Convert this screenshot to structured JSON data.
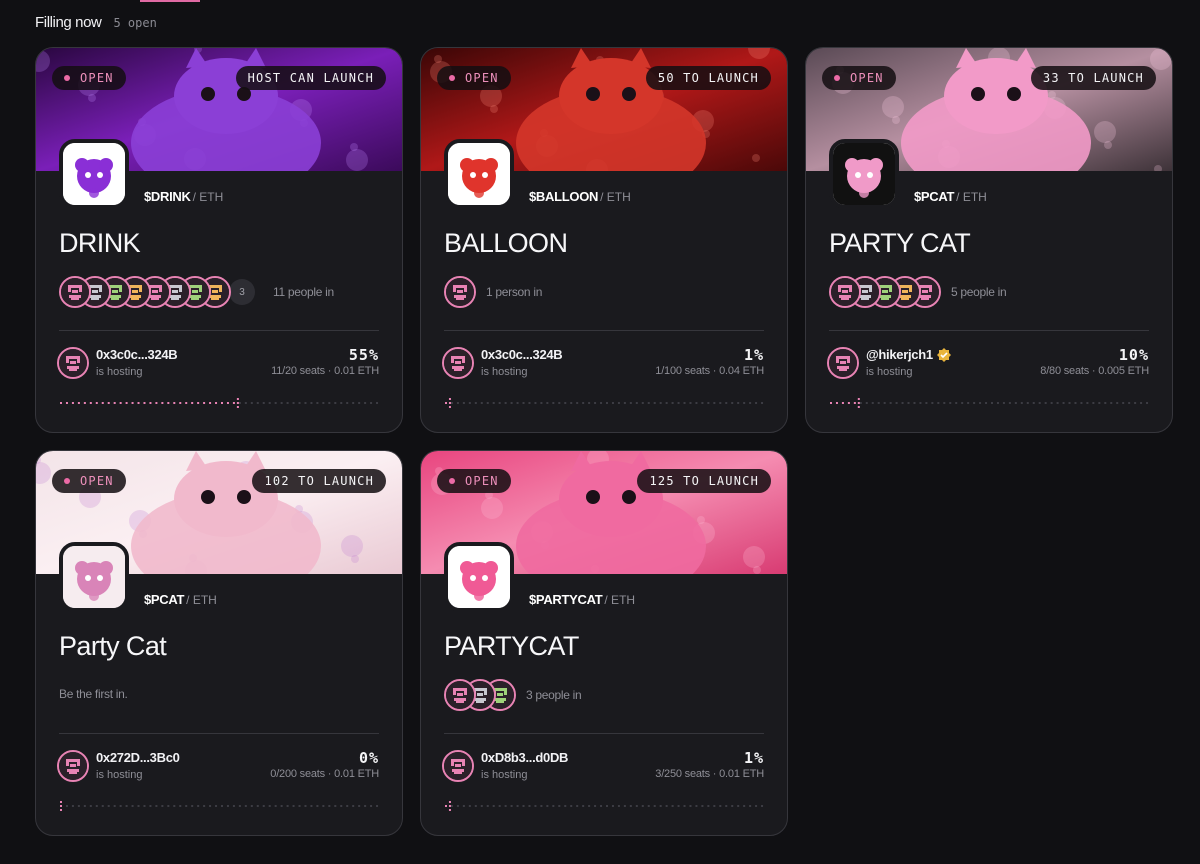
{
  "header": {
    "title": "Filling now",
    "count": "5 open"
  },
  "cards": [
    {
      "status": "OPEN",
      "launch": "HOST CAN LAUNCH",
      "ticker": "$DRINK",
      "pair": "/ ETH",
      "name": "DRINK",
      "people_more": "3",
      "people_text": "11 people in",
      "host": "0x3c0c...324B",
      "host_sub": "is hosting",
      "percent": "55%",
      "seats": "11/20 seats · 0.01 ETH",
      "progress": 0.55
    },
    {
      "status": "OPEN",
      "launch": "50 TO LAUNCH",
      "ticker": "$BALLOON",
      "pair": "/ ETH",
      "name": "BALLOON",
      "people_text": "1 person in",
      "host": "0x3c0c...324B",
      "host_sub": "is hosting",
      "percent": "1%",
      "seats": "1/100 seats · 0.04 ETH",
      "progress": 0.01
    },
    {
      "status": "OPEN",
      "launch": "33 TO LAUNCH",
      "ticker": "$PCAT",
      "pair": "/ ETH",
      "name": "PARTY CAT",
      "people_text": "5 people in",
      "host": "@hikerjch1",
      "host_sub": "is hosting",
      "percent": "10%",
      "seats": "8/80 seats · 0.005 ETH",
      "progress": 0.1
    },
    {
      "status": "OPEN",
      "launch": "102 TO LAUNCH",
      "ticker": "$PCAT",
      "pair": "/ ETH",
      "name": "Party Cat",
      "first_in": "Be the first in.",
      "host": "0x272D...3Bc0",
      "host_sub": "is hosting",
      "percent": "0%",
      "seats": "0/200 seats · 0.01 ETH",
      "progress": 0
    },
    {
      "status": "OPEN",
      "launch": "125 TO LAUNCH",
      "ticker": "$PARTYCAT",
      "pair": "/ ETH",
      "name": "PARTYCAT",
      "people_text": "3 people in",
      "host": "0xD8b3...d0DB",
      "host_sub": "is hosting",
      "percent": "1%",
      "seats": "3/250 seats · 0.01 ETH",
      "progress": 0.01
    }
  ],
  "colors": {
    "accent": "#e883b4",
    "card_bg": "#1a1a1e",
    "page_bg": "#101013"
  },
  "icons": [
    "pixel-avatar-icon",
    "verified-badge-icon",
    "status-dot-icon"
  ]
}
